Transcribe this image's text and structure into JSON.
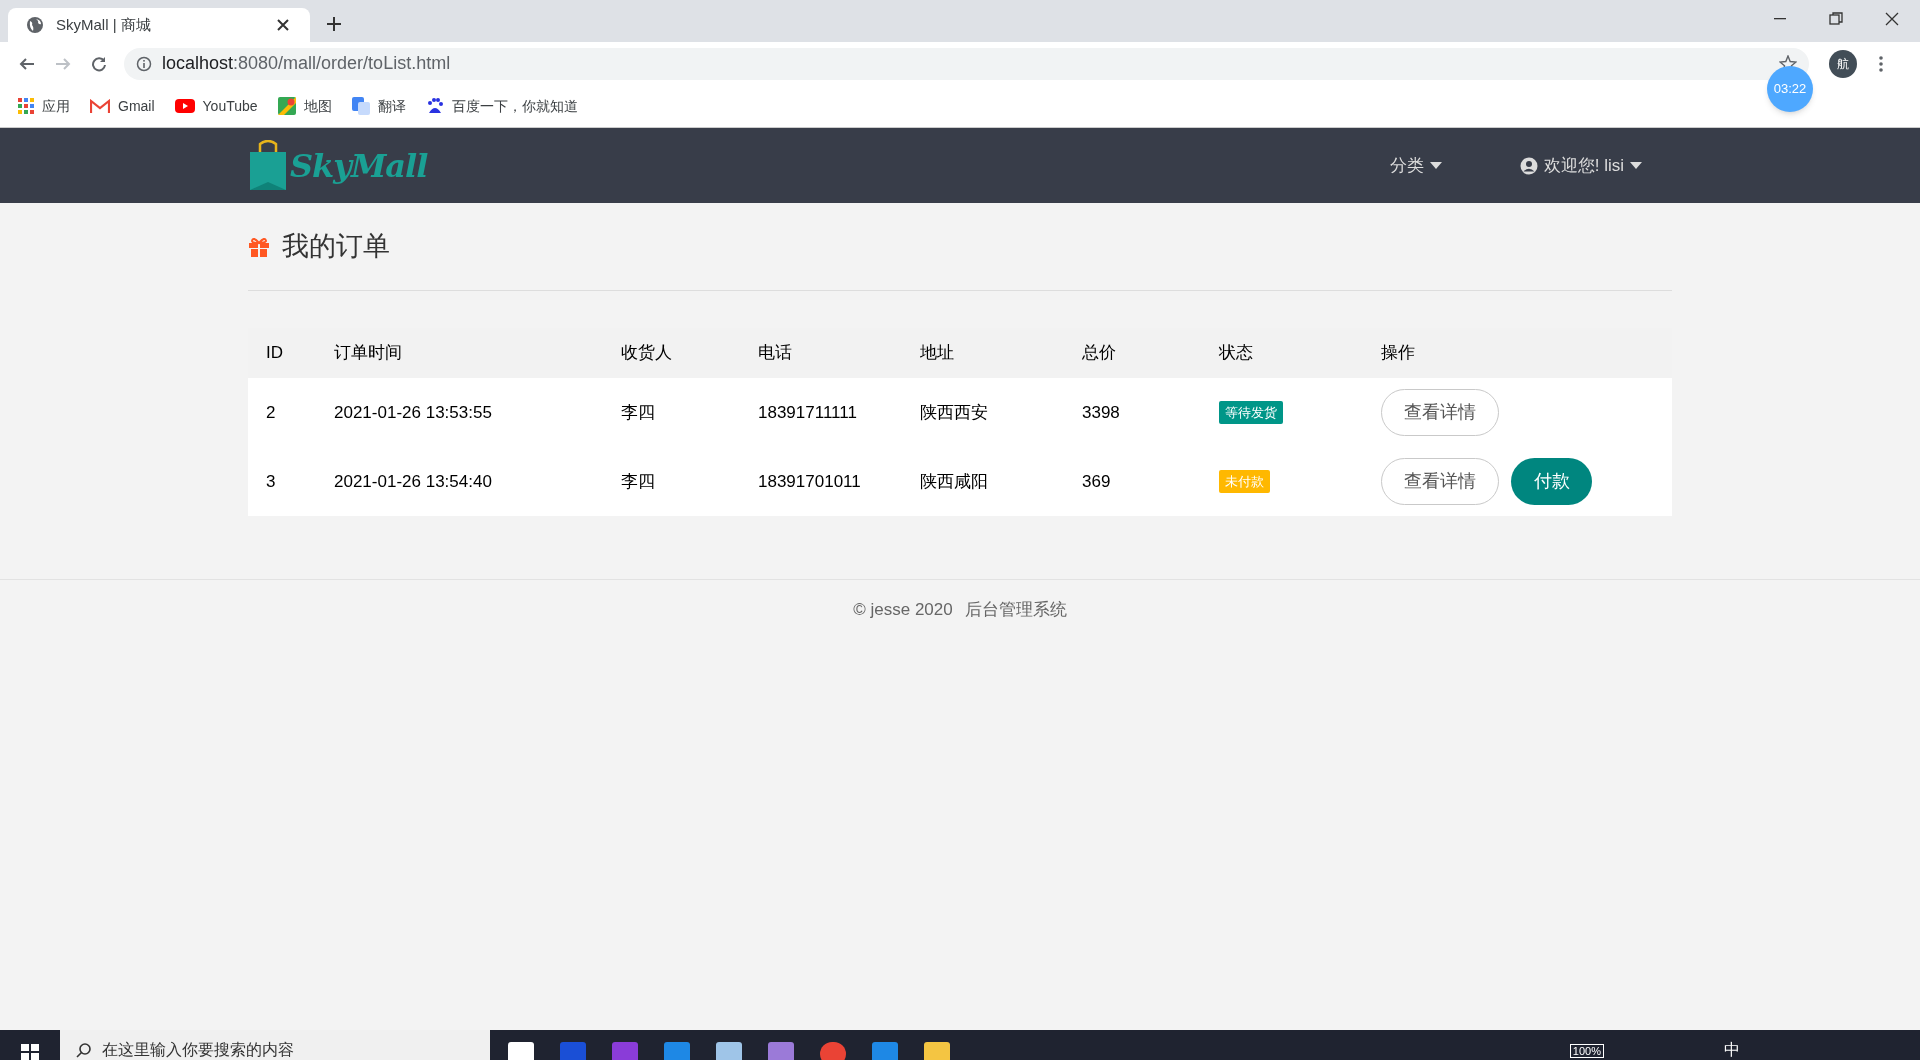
{
  "browser": {
    "tab": {
      "title": "SkyMall | 商城"
    },
    "address": {
      "host": "localhost",
      "path": ":8080/mall/order/toList.html"
    },
    "profile": "航",
    "timer": "03:22",
    "bookmarks": [
      {
        "kind": "apps",
        "label": "应用"
      },
      {
        "kind": "gmail",
        "label": "Gmail"
      },
      {
        "kind": "youtube",
        "label": "YouTube"
      },
      {
        "kind": "maps",
        "label": "地图"
      },
      {
        "kind": "translate",
        "label": "翻译"
      },
      {
        "kind": "baidu",
        "label": "百度一下，你就知道"
      }
    ]
  },
  "navbar": {
    "logo": "SkyMall",
    "menus": [
      {
        "kind": "plain",
        "label": "分类"
      },
      {
        "kind": "user",
        "label": "欢迎您! lisi"
      }
    ]
  },
  "page": {
    "title": "我的订单"
  },
  "table": {
    "columns": [
      "ID",
      "订单时间",
      "收货人",
      "电话",
      "地址",
      "总价",
      "状态",
      "操作"
    ],
    "rows": [
      {
        "id": "2",
        "time": "2021-01-26 13:53:55",
        "receiver": "李四",
        "phone": "18391711111",
        "address": "陕西西安",
        "total": "3398",
        "status": {
          "label": "等待发货",
          "color": "#009688"
        },
        "actions": [
          {
            "kind": "outline",
            "label": "查看详情"
          }
        ]
      },
      {
        "id": "3",
        "time": "2021-01-26 13:54:40",
        "receiver": "李四",
        "phone": "18391701011",
        "address": "陕西咸阳",
        "total": "369",
        "status": {
          "label": "未付款",
          "color": "#ffb800"
        },
        "actions": [
          {
            "kind": "outline",
            "label": "查看详情"
          },
          {
            "kind": "primary",
            "label": "付款"
          }
        ]
      }
    ]
  },
  "footer": {
    "copyright": "© jesse 2020",
    "link": "后台管理系统"
  },
  "taskbar": {
    "search": {
      "placeholder": "在这里输入你要搜索的内容"
    },
    "battery": "100%",
    "ime": "中"
  }
}
